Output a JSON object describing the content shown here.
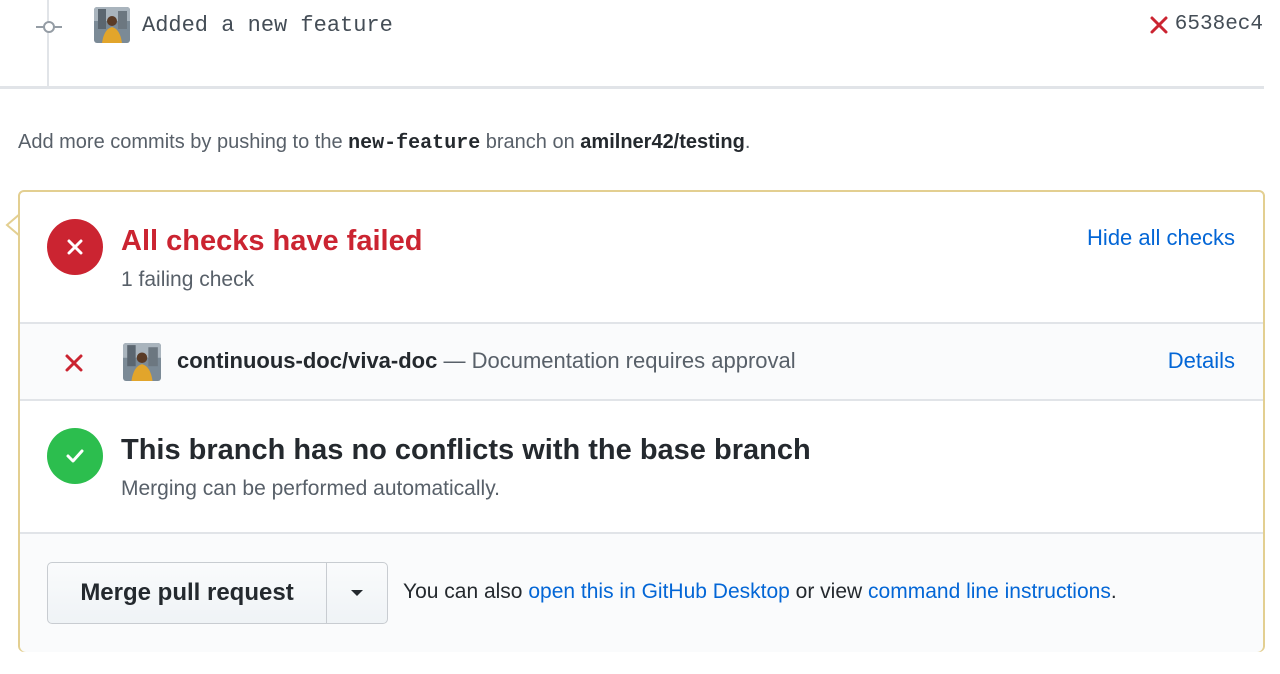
{
  "commit": {
    "message": "Added a new feature",
    "sha": "6538ec4",
    "status_icon": "x-icon",
    "status_color": "#cb2431"
  },
  "hint": {
    "prefix": "Add more commits by pushing to the",
    "branch": "new-feature",
    "middle": "branch on",
    "repo": "amilner42/testing",
    "suffix": "."
  },
  "checks": {
    "title": "All checks have failed",
    "subtitle": "1 failing check",
    "toggle_label": "Hide all checks",
    "items": [
      {
        "name": "continuous-doc/viva-doc",
        "separator": " — ",
        "description": "Documentation requires approval",
        "details_label": "Details",
        "state": "failed"
      }
    ]
  },
  "conflicts": {
    "title": "This branch has no conflicts with the base branch",
    "subtitle": "Merging can be performed automatically."
  },
  "merge": {
    "button_label": "Merge pull request",
    "help_prefix": "You can also",
    "link_desktop": "open this in GitHub Desktop",
    "help_middle": "or view",
    "link_cli": "command line instructions",
    "help_suffix": "."
  },
  "colors": {
    "fail": "#cb2431",
    "success": "#2cbe4e",
    "link": "#0366d6",
    "box_border": "#e3cf91"
  }
}
